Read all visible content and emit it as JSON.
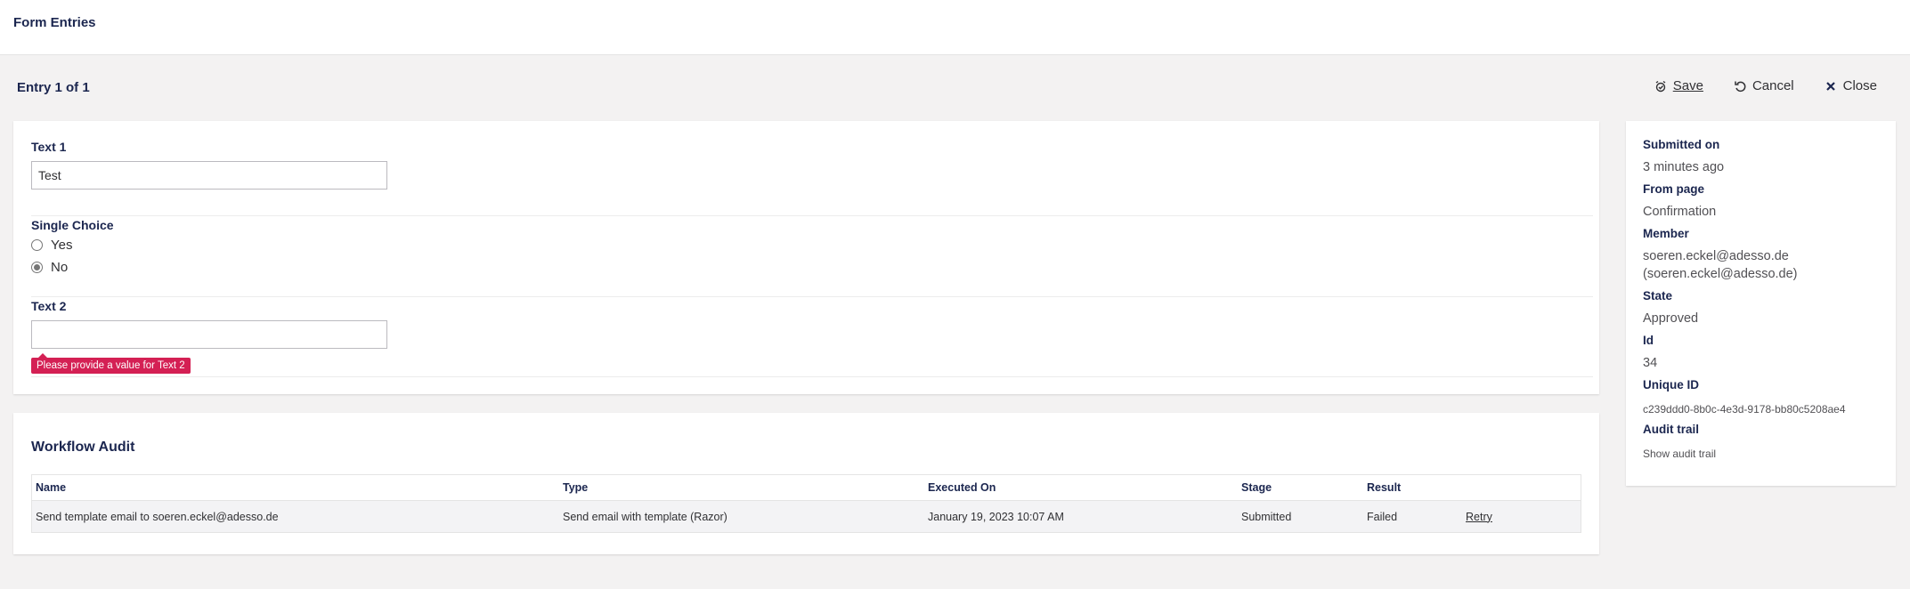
{
  "header": {
    "title": "Form Entries"
  },
  "entry": {
    "heading": "Entry 1 of 1"
  },
  "toolbar": {
    "save_label": "Save",
    "cancel_label": "Cancel",
    "close_label": "Close"
  },
  "form": {
    "text1": {
      "label": "Text 1",
      "value": "Test"
    },
    "single_choice": {
      "label": "Single Choice",
      "options": [
        {
          "label": "Yes",
          "checked": false
        },
        {
          "label": "No",
          "checked": true
        }
      ]
    },
    "text2": {
      "label": "Text 2",
      "value": "",
      "error": "Please provide a value for Text 2"
    }
  },
  "audit": {
    "title": "Workflow Audit",
    "columns": [
      "Name",
      "Type",
      "Executed On",
      "Stage",
      "Result"
    ],
    "rows": [
      {
        "name": "Send template email to soeren.eckel@adesso.de",
        "type": "Send email with template (Razor)",
        "executed_on": "January 19, 2023 10:07 AM",
        "stage": "Submitted",
        "result": "Failed",
        "action": "Retry"
      }
    ]
  },
  "info": {
    "submitted_on_label": "Submitted on",
    "submitted_on": "3 minutes ago",
    "from_page_label": "From page",
    "from_page": "Confirmation",
    "member_label": "Member",
    "member_line1": "soeren.eckel@adesso.de",
    "member_line2": "(soeren.eckel@adesso.de)",
    "state_label": "State",
    "state": "Approved",
    "id_label": "Id",
    "id": "34",
    "unique_id_label": "Unique ID",
    "unique_id": "c239ddd0-8b0c-4e3d-9178-bb80c5208ae4",
    "audit_trail_label": "Audit trail",
    "audit_trail_link": "Show audit trail"
  }
}
